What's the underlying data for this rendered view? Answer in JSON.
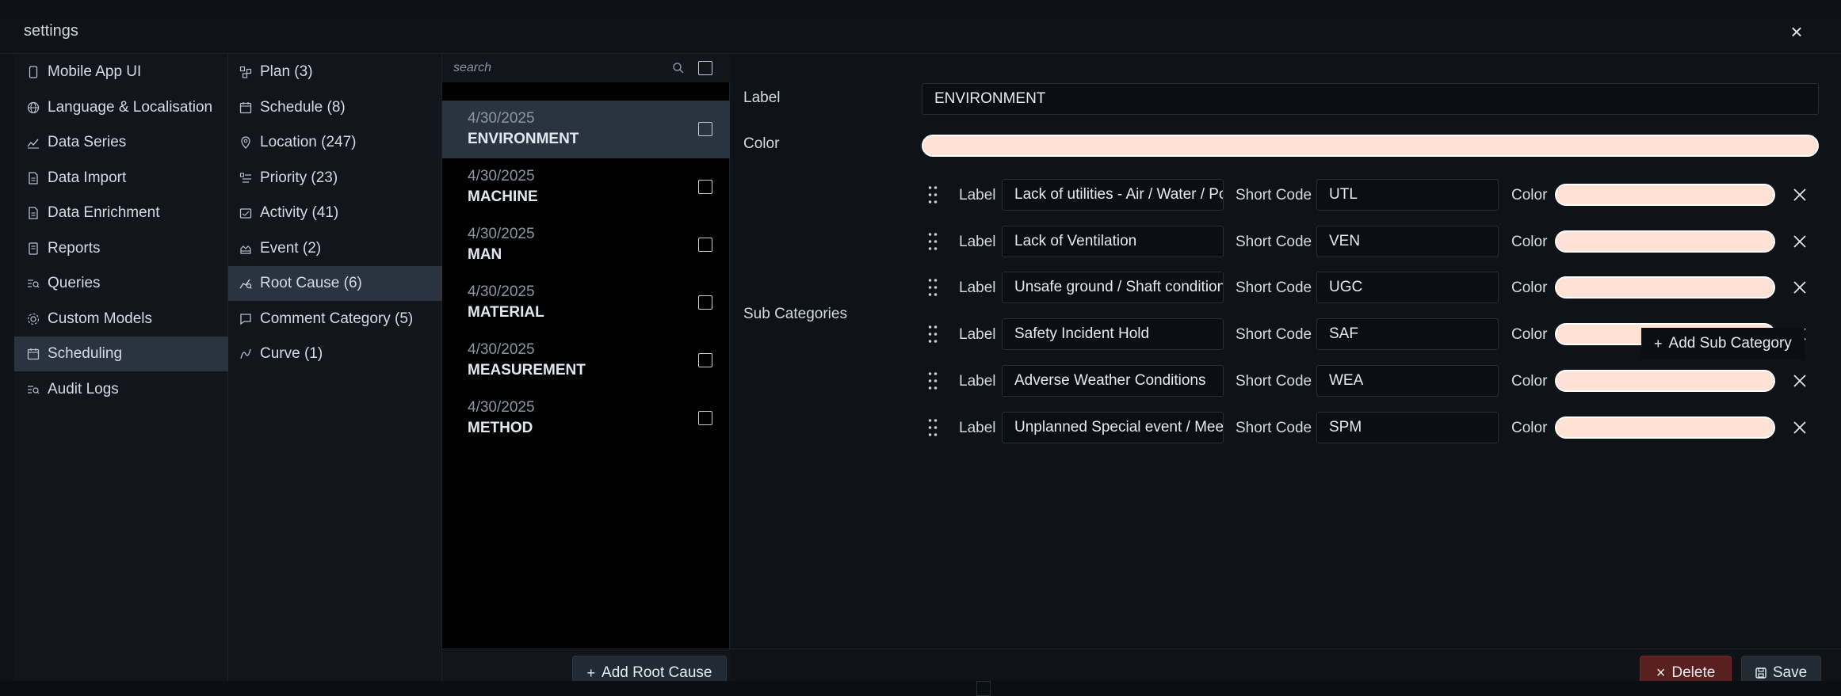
{
  "modal": {
    "title": "settings"
  },
  "nav": [
    {
      "label": "Mobile App UI",
      "icon": "phone-icon"
    },
    {
      "label": "Language & Localisation",
      "icon": "globe-icon"
    },
    {
      "label": "Data Series",
      "icon": "line-chart-icon"
    },
    {
      "label": "Data Import",
      "icon": "document-icon"
    },
    {
      "label": "Data Enrichment",
      "icon": "document-icon"
    },
    {
      "label": "Reports",
      "icon": "report-icon"
    },
    {
      "label": "Queries",
      "icon": "query-icon"
    },
    {
      "label": "Custom Models",
      "icon": "model-icon"
    },
    {
      "label": "Scheduling",
      "icon": "calendar-icon",
      "active": true
    },
    {
      "label": "Audit Logs",
      "icon": "query-icon"
    }
  ],
  "subnav": [
    {
      "label": "Plan (3)",
      "icon": "plan-icon"
    },
    {
      "label": "Schedule (8)",
      "icon": "calendar-icon"
    },
    {
      "label": "Location (247)",
      "icon": "pin-icon"
    },
    {
      "label": "Priority (23)",
      "icon": "priority-icon"
    },
    {
      "label": "Activity (41)",
      "icon": "activity-icon"
    },
    {
      "label": "Event (2)",
      "icon": "event-icon"
    },
    {
      "label": "Root Cause (6)",
      "icon": "root-cause-icon",
      "active": true
    },
    {
      "label": "Comment Category (5)",
      "icon": "comment-icon"
    },
    {
      "label": "Curve (1)",
      "icon": "curve-icon"
    }
  ],
  "list": {
    "search_placeholder": "search",
    "items": [
      {
        "date": "4/30/2025",
        "name": "ENVIRONMENT",
        "active": true
      },
      {
        "date": "4/30/2025",
        "name": "MACHINE"
      },
      {
        "date": "4/30/2025",
        "name": "MAN"
      },
      {
        "date": "4/30/2025",
        "name": "MATERIAL"
      },
      {
        "date": "4/30/2025",
        "name": "MEASUREMENT"
      },
      {
        "date": "4/30/2025",
        "name": "METHOD"
      }
    ],
    "add_label": "Add Root Cause"
  },
  "detail": {
    "label_caption": "Label",
    "label_value": "ENVIRONMENT",
    "color_caption": "Color",
    "color_value": "#ffe2d3",
    "subcats_caption": "Sub Categories",
    "row_label_caption": "Label",
    "row_code_caption": "Short Code",
    "row_color_caption": "Color",
    "subcategories": [
      {
        "label": "Lack of utilities  - Air / Water / Power",
        "code": "UTL",
        "color": "#ffe2d3"
      },
      {
        "label": "Lack of Ventilation",
        "code": "VEN",
        "color": "#ffe2d3"
      },
      {
        "label": "Unsafe ground / Shaft conditions",
        "code": "UGC",
        "color": "#ffe2d3"
      },
      {
        "label": "Safety Incident Hold",
        "code": "SAF",
        "color": "#ffe2d3"
      },
      {
        "label": "Adverse Weather Conditions",
        "code": "WEA",
        "color": "#ffe2d3"
      },
      {
        "label": "Unplanned Special event / Meeting",
        "code": "SPM",
        "color": "#ffe2d3"
      }
    ],
    "add_sub_label": "Add Sub Category",
    "delete_label": "Delete",
    "save_label": "Save"
  }
}
